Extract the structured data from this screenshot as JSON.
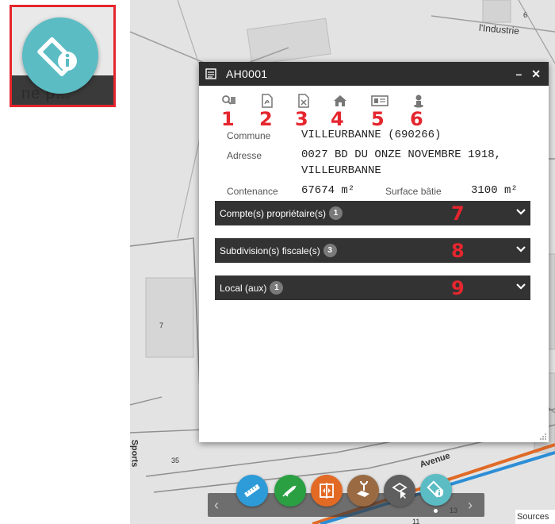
{
  "popup": {
    "title": "AH0001",
    "minimize_label": "–",
    "close_label": "✕",
    "toolbar_numbers": [
      "1",
      "2",
      "3",
      "4",
      "5",
      "6"
    ],
    "fields": {
      "commune_label": "Commune",
      "commune_value": "VILLEURBANNE (690266)",
      "adresse_label": "Adresse",
      "adresse_line1": "0027 BD DU ONZE NOVEMBRE 1918,",
      "adresse_line2": "VILLEURBANNE",
      "contenance_label": "Contenance",
      "contenance_value": "67674 m²",
      "surface_label": "Surface bâtie",
      "surface_value": "3100 m²"
    },
    "sections": [
      {
        "label": "Compte(s) propriétaire(s)",
        "count": "1",
        "number": "7"
      },
      {
        "label": "Subdivision(s) fiscale(s)",
        "count": "3",
        "number": "8"
      },
      {
        "label": "Local (aux)",
        "count": "1",
        "number": "9"
      }
    ]
  },
  "inset": {
    "text": "ne p..."
  },
  "map": {
    "labels": {
      "industrie": "l'Industrie",
      "n6": "6",
      "n7": "7",
      "n35": "35",
      "n11": "11",
      "n13": "13",
      "sports": "Sports",
      "avenue": "Avenue"
    }
  },
  "footer": {
    "sources_label": "Sources"
  },
  "colors": {
    "header": "#2e2e2e",
    "annotation_red": "#e5262e",
    "tool_blue": "#2d9bd8",
    "tool_green": "#2aa043",
    "tool_orange": "#e26a25",
    "tool_brown": "#9a6b43",
    "tool_gray": "#5f5f5f",
    "tool_teal": "#5bbcc4"
  }
}
